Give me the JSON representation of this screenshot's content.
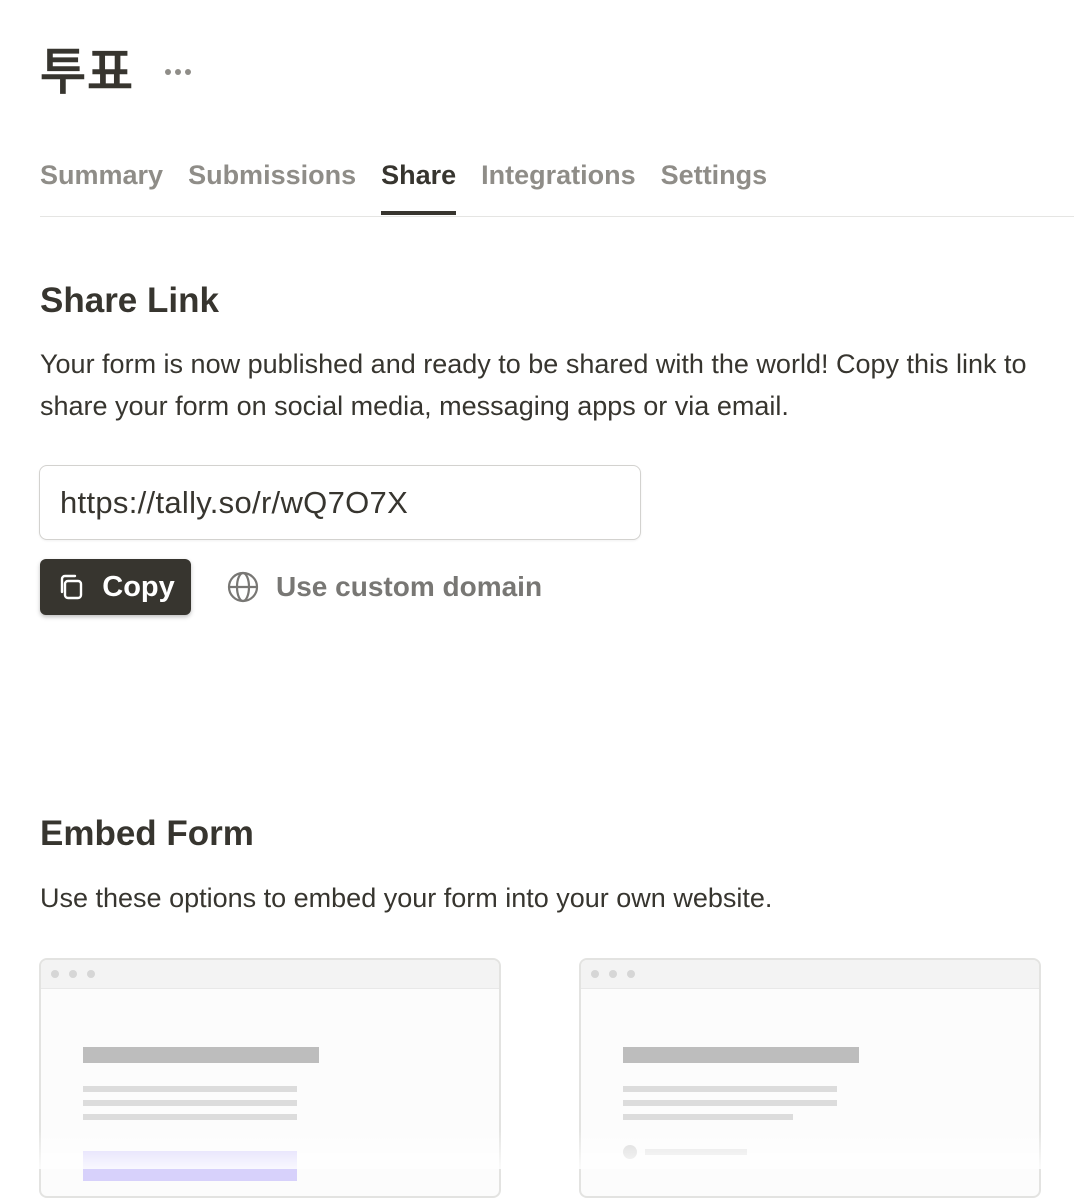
{
  "page": {
    "title": "투표"
  },
  "tabs": [
    {
      "label": "Summary",
      "active": false
    },
    {
      "label": "Submissions",
      "active": false
    },
    {
      "label": "Share",
      "active": true
    },
    {
      "label": "Integrations",
      "active": false
    },
    {
      "label": "Settings",
      "active": false
    }
  ],
  "share_link": {
    "heading": "Share Link",
    "description": "Your form is now published and ready to be shared with the world! Copy this link to share your form on social media, messaging apps or via email.",
    "url": "https://tally.so/r/wQ7O7X",
    "copy_label": "Copy",
    "custom_domain_label": "Use custom domain"
  },
  "embed_form": {
    "heading": "Embed Form",
    "description": "Use these options to embed your form into your own website."
  },
  "colors": {
    "text": "#37352f",
    "muted": "#787774",
    "tab_inactive": "#8f8d88",
    "button_bg": "#37352f",
    "accent_preview": "#d7d1fb"
  },
  "icons": {
    "more": "more-horizontal-icon",
    "copy": "copy-icon",
    "globe": "globe-icon"
  }
}
